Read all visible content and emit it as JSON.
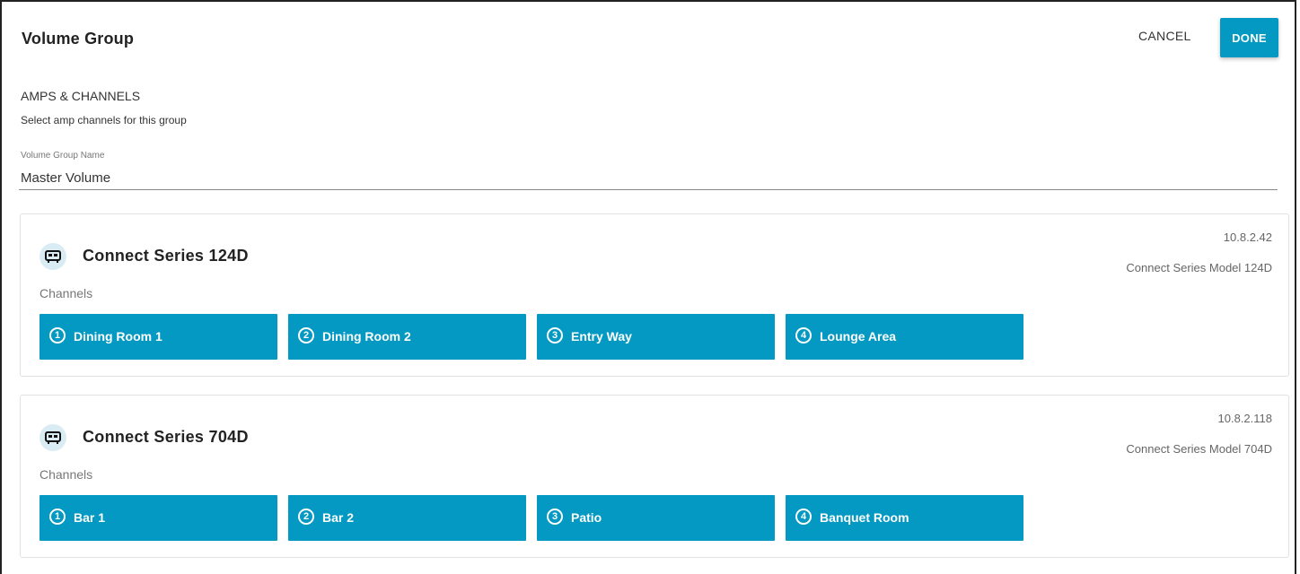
{
  "header": {
    "title": "Volume Group",
    "cancel_label": "CANCEL",
    "done_label": "DONE"
  },
  "section": {
    "title": "AMPS & CHANNELS",
    "subtitle": "Select amp channels for this group"
  },
  "group_name": {
    "label": "Volume Group Name",
    "value": "Master Volume"
  },
  "amps": [
    {
      "name": "Connect Series 124D",
      "ip": "10.8.2.42",
      "model": "Connect Series Model 124D",
      "channels_label": "Channels",
      "channels": [
        {
          "num": "1",
          "name": "Dining Room 1"
        },
        {
          "num": "2",
          "name": "Dining Room 2"
        },
        {
          "num": "3",
          "name": "Entry Way"
        },
        {
          "num": "4",
          "name": "Lounge Area"
        }
      ]
    },
    {
      "name": "Connect Series 704D",
      "ip": "10.8.2.118",
      "model": "Connect Series Model 704D",
      "channels_label": "Channels",
      "channels": [
        {
          "num": "1",
          "name": "Bar 1"
        },
        {
          "num": "2",
          "name": "Bar 2"
        },
        {
          "num": "3",
          "name": "Patio"
        },
        {
          "num": "4",
          "name": "Banquet Room"
        }
      ]
    }
  ],
  "colors": {
    "accent": "#0399c2",
    "icon_bg": "#d9ecf4"
  },
  "icons": {
    "amp": "amplifier-icon"
  }
}
